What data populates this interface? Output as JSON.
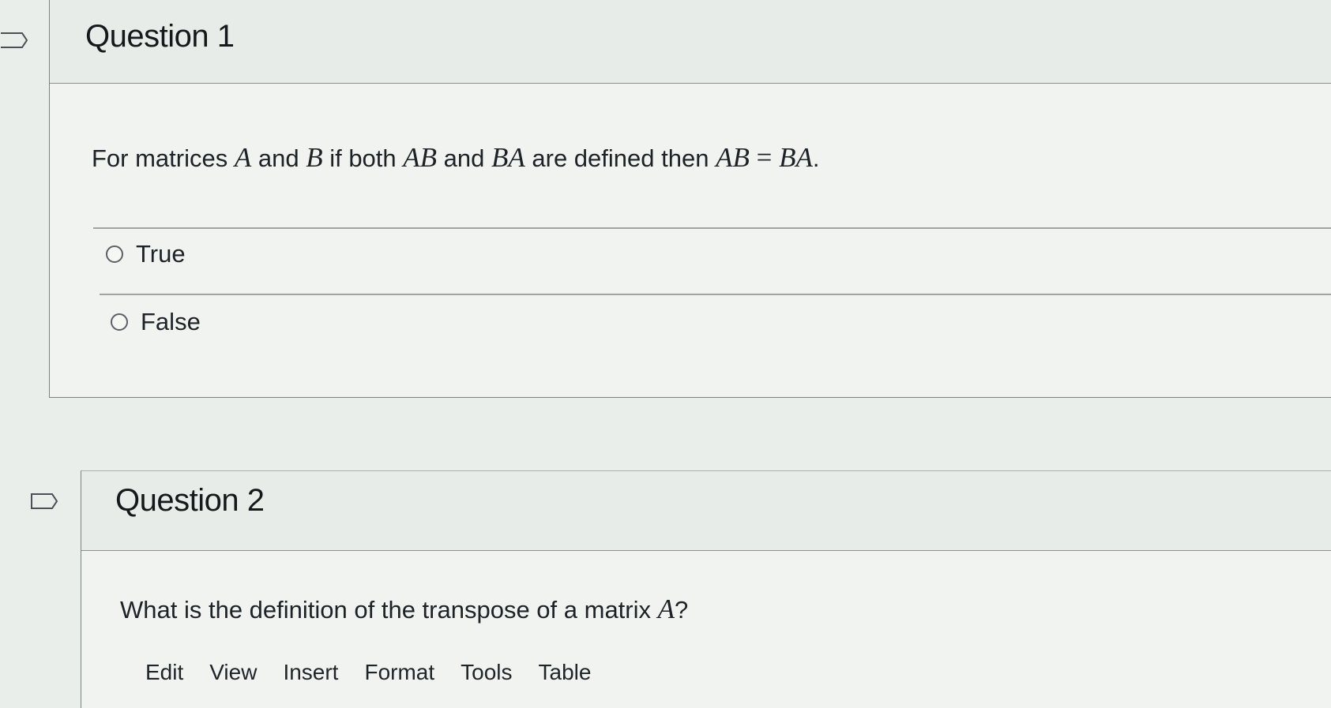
{
  "question1": {
    "title": "Question 1",
    "text_prefix": "For matrices ",
    "m1": "A",
    "t1": " and ",
    "m2": "B",
    "t2": " if both ",
    "m3": "AB",
    "t3": " and ",
    "m4": "BA",
    "t4": " are defined then ",
    "m5a": "AB",
    "m5op": " = ",
    "m5b": "BA",
    "t5": ".",
    "options": [
      {
        "label": "True",
        "selected": false
      },
      {
        "label": "False",
        "selected": false
      }
    ]
  },
  "question2": {
    "title": "Question 2",
    "text_prefix": "What is the definition of the transpose of a matrix ",
    "m1": "A",
    "t1": "?",
    "toolbar": [
      "Edit",
      "View",
      "Insert",
      "Format",
      "Tools",
      "Table"
    ]
  },
  "icons": {
    "flag": "flag-icon",
    "radio": "radio-unchecked-icon"
  },
  "colors": {
    "border": "#7c827f",
    "text": "#1d2226"
  }
}
